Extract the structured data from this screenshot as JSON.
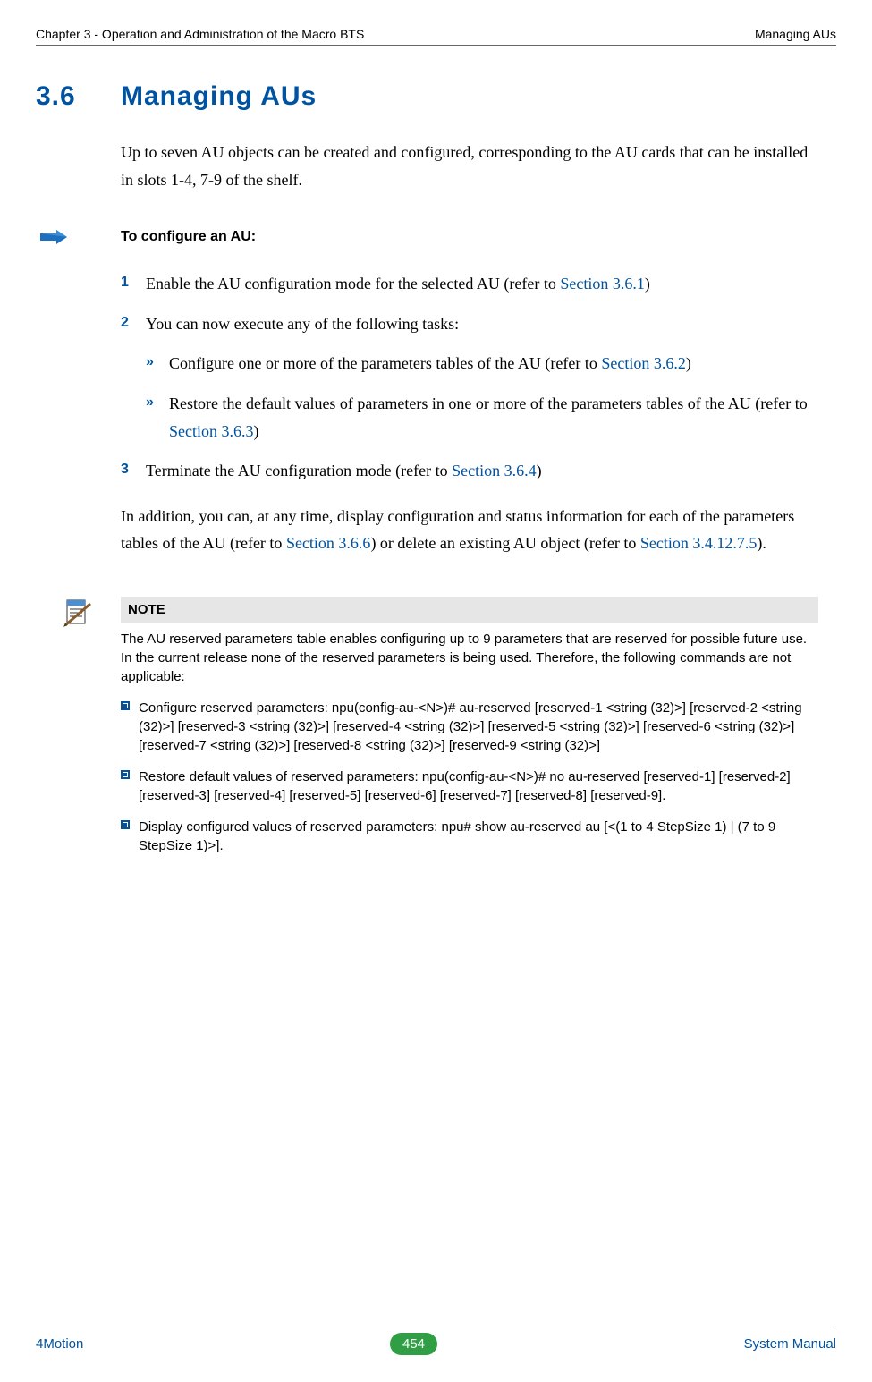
{
  "header": {
    "left": "Chapter 3 - Operation and Administration of the Macro BTS",
    "right": "Managing AUs"
  },
  "section": {
    "number": "3.6",
    "title": "Managing AUs"
  },
  "intro": "Up to seven AU objects can be created and configured, corresponding to the AU cards that can be installed in slots 1-4, 7-9 of the shelf.",
  "procedure": {
    "title": "To configure an AU:"
  },
  "steps": {
    "s1": {
      "num": "1",
      "pre": "Enable the AU configuration mode for the selected AU (refer to ",
      "link": "Section 3.6.1",
      "post": ")"
    },
    "s2": {
      "num": "2",
      "text": "You can now execute any of the following tasks:"
    },
    "s2a": {
      "marker": "»",
      "pre": "Configure one or more of the parameters tables of the AU (refer to ",
      "link": "Section 3.6.2",
      "post": ")"
    },
    "s2b": {
      "marker": "»",
      "pre": "Restore the default values of parameters in one or more of the parameters tables of the AU (refer to ",
      "link": "Section 3.6.3",
      "post": ")"
    },
    "s3": {
      "num": "3",
      "pre": "Terminate the AU configuration mode (refer to ",
      "link": "Section 3.6.4",
      "post": ")"
    }
  },
  "addition": {
    "pre": "In addition, you can, at any time, display configuration and status information for each of the parameters tables of the AU (refer to ",
    "link1": "Section 3.6.6",
    "mid": ") or delete an existing AU object (refer to ",
    "link2": "Section 3.4.12.7.5",
    "post": ")."
  },
  "note": {
    "label": "NOTE",
    "intro": "The AU reserved parameters table enables configuring up to 9 parameters that are reserved for possible future use. In the current release none of the reserved parameters is being used. Therefore, the following commands are not applicable:",
    "b1": "Configure reserved parameters: npu(config-au-<N>)# au-reserved [reserved-1 <string (32)>] [reserved-2 <string (32)>] [reserved-3 <string (32)>] [reserved-4 <string (32)>] [reserved-5 <string (32)>] [reserved-6 <string (32)>] [reserved-7 <string (32)>] [reserved-8 <string (32)>] [reserved-9 <string (32)>]",
    "b2": "Restore default values of reserved parameters: npu(config-au-<N>)# no au-reserved [reserved-1] [reserved-2] [reserved-3] [reserved-4] [reserved-5] [reserved-6] [reserved-7] [reserved-8] [reserved-9].",
    "b3": "Display configured values of reserved parameters: npu# show au-reserved au [<(1 to 4 StepSize 1) | (7 to 9 StepSize 1)>]."
  },
  "footer": {
    "left": "4Motion",
    "page": "454",
    "right": "System Manual"
  }
}
